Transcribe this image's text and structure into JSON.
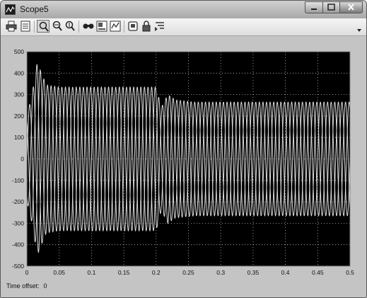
{
  "window": {
    "title": "Scope5"
  },
  "toolbar": {
    "buttons": [
      {
        "name": "print-icon"
      },
      {
        "name": "parameters-icon"
      },
      {
        "name": "zoom-icon",
        "active": true
      },
      {
        "name": "zoom-x-icon"
      },
      {
        "name": "zoom-y-icon"
      },
      {
        "name": "autoscale-icon"
      },
      {
        "name": "save-axes-settings-icon"
      },
      {
        "name": "restore-axes-settings-icon"
      },
      {
        "name": "floating-scope-icon"
      },
      {
        "name": "lock-axes-icon"
      },
      {
        "name": "signal-selection-icon"
      }
    ]
  },
  "status": {
    "label": "Time offset:",
    "value": "0"
  },
  "colors": {
    "plot_background": "#000000",
    "axes_frame": "#c4c4c4",
    "trace": "#dcdcdc",
    "grid": "#ffffff"
  },
  "chart_data": {
    "type": "line",
    "title": "",
    "xlabel": "",
    "ylabel": "",
    "xlim": [
      0,
      0.5
    ],
    "ylim": [
      -500,
      500
    ],
    "grid": true,
    "xticks": [
      0,
      0.05,
      0.1,
      0.15,
      0.2,
      0.25,
      0.3,
      0.35,
      0.4,
      0.45,
      0.5
    ],
    "xtick_labels": [
      "0",
      "0.05",
      "0.1",
      "0.15",
      "0.2",
      "0.25",
      "0.3",
      "0.35",
      "0.4",
      "0.45",
      "0.5"
    ],
    "yticks": [
      -500,
      -400,
      -300,
      -200,
      -100,
      0,
      100,
      200,
      300,
      400,
      500
    ],
    "ytick_labels": [
      "-500",
      "-400",
      "-300",
      "-200",
      "-100",
      "0",
      "100",
      "200",
      "300",
      "400",
      "500"
    ],
    "series": [
      {
        "frequency_hz": 60,
        "phase_deg": 0,
        "envelope": [
          [
            0,
            200
          ],
          [
            0.008,
            300
          ],
          [
            0.016,
            450
          ],
          [
            0.03,
            345
          ],
          [
            0.05,
            335
          ],
          [
            0.2,
            335
          ],
          [
            0.208,
            240
          ],
          [
            0.218,
            300
          ],
          [
            0.23,
            275
          ],
          [
            0.26,
            265
          ],
          [
            0.5,
            265
          ]
        ]
      },
      {
        "frequency_hz": 60,
        "phase_deg": -120,
        "envelope": [
          [
            0,
            200
          ],
          [
            0.008,
            300
          ],
          [
            0.016,
            450
          ],
          [
            0.03,
            345
          ],
          [
            0.05,
            335
          ],
          [
            0.2,
            335
          ],
          [
            0.208,
            240
          ],
          [
            0.218,
            300
          ],
          [
            0.23,
            275
          ],
          [
            0.26,
            265
          ],
          [
            0.5,
            265
          ]
        ]
      },
      {
        "frequency_hz": 60,
        "phase_deg": 120,
        "envelope": [
          [
            0,
            200
          ],
          [
            0.008,
            300
          ],
          [
            0.016,
            450
          ],
          [
            0.03,
            345
          ],
          [
            0.05,
            335
          ],
          [
            0.2,
            335
          ],
          [
            0.208,
            240
          ],
          [
            0.218,
            300
          ],
          [
            0.23,
            275
          ],
          [
            0.26,
            265
          ],
          [
            0.5,
            265
          ]
        ]
      }
    ]
  }
}
